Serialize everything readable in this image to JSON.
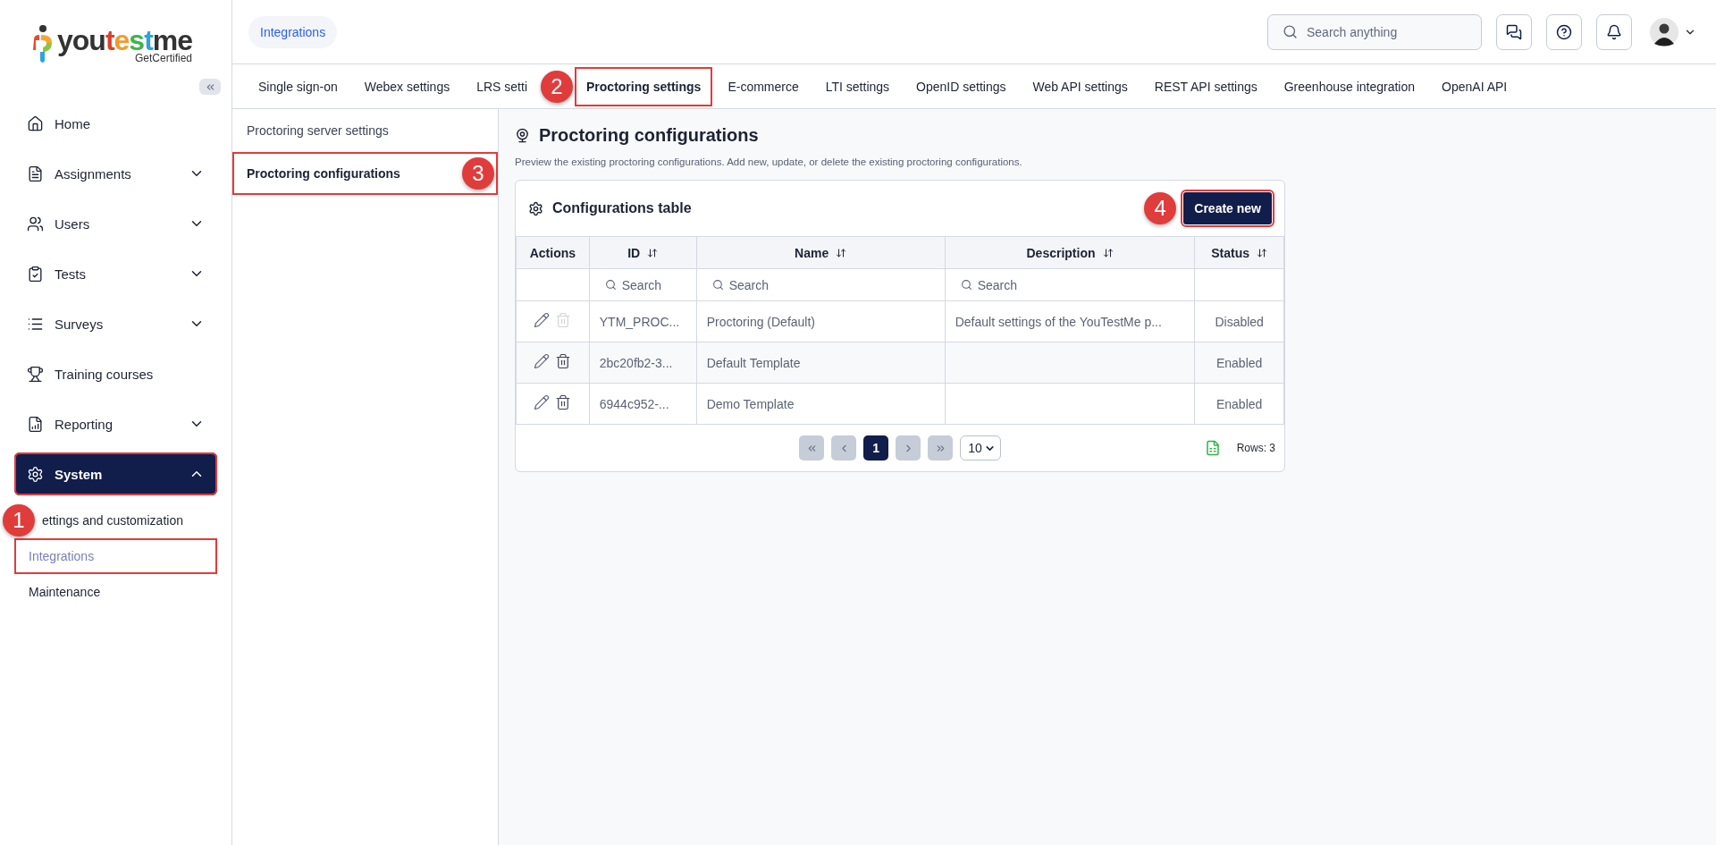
{
  "logo": {
    "name": "youtestme",
    "tagline": "GetCertified"
  },
  "sidebar": {
    "items": [
      {
        "label": "Home",
        "selected": false,
        "highlighted": false
      },
      {
        "label": "Assignments",
        "expanded": false,
        "selected": false,
        "highlighted": false
      },
      {
        "label": "Users",
        "expanded": false,
        "selected": false,
        "highlighted": false
      },
      {
        "label": "Tests",
        "expanded": false,
        "selected": false,
        "highlighted": false
      },
      {
        "label": "Surveys",
        "expanded": false,
        "selected": false,
        "highlighted": false
      },
      {
        "label": "Training courses",
        "selected": false,
        "highlighted": false
      },
      {
        "label": "Reporting",
        "expanded": false,
        "selected": false,
        "highlighted": false
      },
      {
        "label": "System",
        "expanded": true,
        "selected": true,
        "highlighted": true,
        "children": [
          {
            "label": "ettings and customization",
            "selected": false,
            "highlighted": false,
            "callout": "1"
          },
          {
            "label": "Integrations",
            "selected": true,
            "highlighted": true
          },
          {
            "label": "Maintenance",
            "selected": false,
            "highlighted": false
          }
        ]
      }
    ]
  },
  "header": {
    "breadcrumb": "Integrations",
    "search": {
      "placeholder": "Search anything"
    }
  },
  "tabs": [
    {
      "label": "Single sign-on",
      "selected": false,
      "highlighted": false
    },
    {
      "label": "Webex settings",
      "selected": false,
      "highlighted": false
    },
    {
      "label": "LRS setti",
      "selected": false,
      "highlighted": false,
      "callout": "2"
    },
    {
      "label": "Proctoring settings",
      "selected": true,
      "highlighted": true
    },
    {
      "label": "E-commerce",
      "selected": false,
      "highlighted": false
    },
    {
      "label": "LTI settings",
      "selected": false,
      "highlighted": false
    },
    {
      "label": "OpenID settings",
      "selected": false,
      "highlighted": false
    },
    {
      "label": "Web API settings",
      "selected": false,
      "highlighted": false
    },
    {
      "label": "REST API settings",
      "selected": false,
      "highlighted": false
    },
    {
      "label": "Greenhouse integration",
      "selected": false,
      "highlighted": false
    },
    {
      "label": "OpenAI API",
      "selected": false,
      "highlighted": false
    }
  ],
  "subnav": [
    {
      "label": "Proctoring server settings",
      "selected": false,
      "highlighted": false
    },
    {
      "label": "Proctoring configurations",
      "selected": true,
      "highlighted": true,
      "callout": "3"
    }
  ],
  "page": {
    "title": "Proctoring configurations",
    "description": "Preview the existing proctoring configurations. Add new, update, or delete the existing proctoring configurations."
  },
  "table": {
    "title": "Configurations table",
    "create_button": {
      "label": "Create new",
      "highlighted": true,
      "callout": "4"
    },
    "columns": [
      {
        "label": "Actions",
        "sortable": false
      },
      {
        "label": "ID",
        "sortable": true,
        "placeholder": "Search"
      },
      {
        "label": "Name",
        "sortable": true,
        "placeholder": "Search"
      },
      {
        "label": "Description",
        "sortable": true,
        "placeholder": "Search"
      },
      {
        "label": "Status",
        "sortable": true
      }
    ],
    "rows": [
      {
        "id": "YTM_PROC...",
        "name": "Proctoring (Default)",
        "description": "Default settings of the YouTestMe p...",
        "status": "Disabled",
        "delete_disabled": true
      },
      {
        "id": "2bc20fb2-3...",
        "name": "Default Template",
        "status": "Enabled",
        "delete_disabled": false
      },
      {
        "id": "6944c952-...",
        "name": "Demo Template",
        "status": "Enabled",
        "delete_disabled": false
      }
    ],
    "pagination": {
      "pages": [
        {
          "label": "1",
          "selected": true
        }
      ],
      "first_disabled": true,
      "prev_disabled": true,
      "next_disabled": true,
      "last_disabled": true,
      "page_size": "10",
      "rows": "Rows: 3"
    }
  }
}
